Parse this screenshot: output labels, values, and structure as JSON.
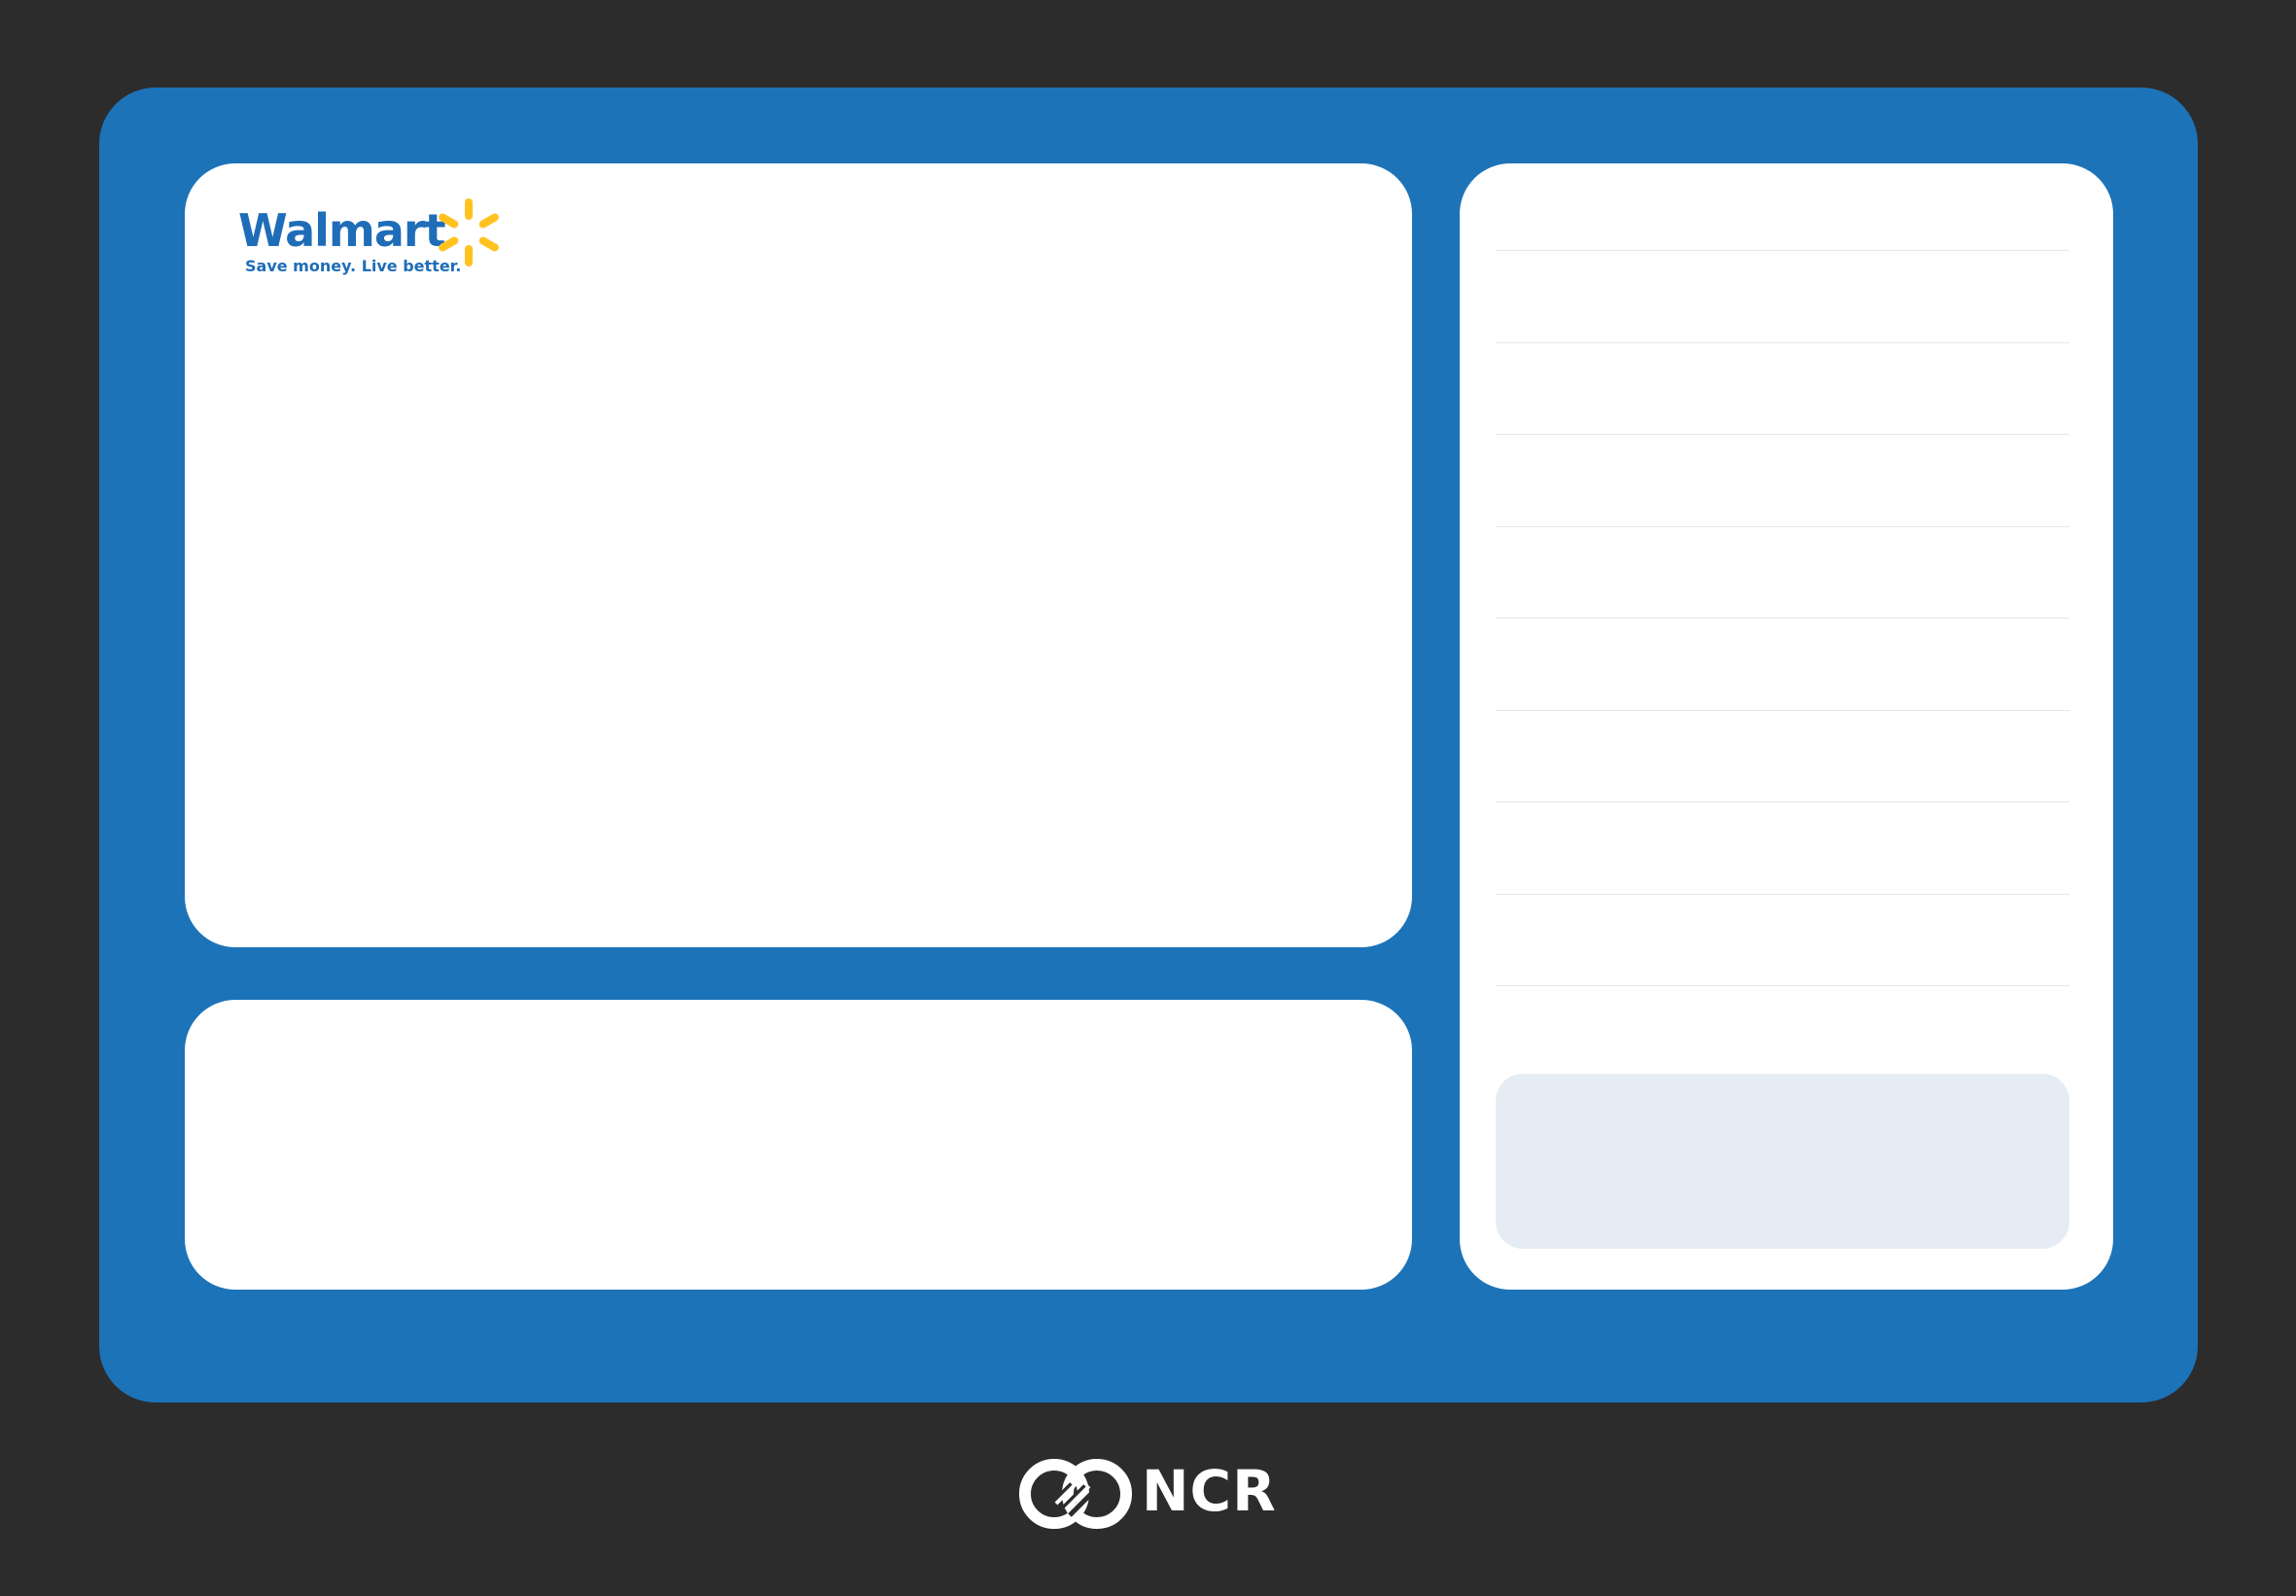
{
  "brand": {
    "name": "Walmart",
    "tagline": "Save money. Live better.",
    "accent_color": "#1f6db8",
    "spark_color": "#ffc220",
    "logo_icon": "walmart-spark-icon"
  },
  "screen": {
    "background_color": "#1c73b8",
    "panel_color": "#ffffff"
  },
  "receipt": {
    "item_rows": [
      "",
      "",
      "",
      "",
      "",
      "",
      "",
      "",
      ""
    ],
    "total_box_color": "#e6ecf3"
  },
  "footer": {
    "vendor": "NCR",
    "vendor_icon": "ncr-logo-icon",
    "bezel_color": "#2c2c2c"
  }
}
